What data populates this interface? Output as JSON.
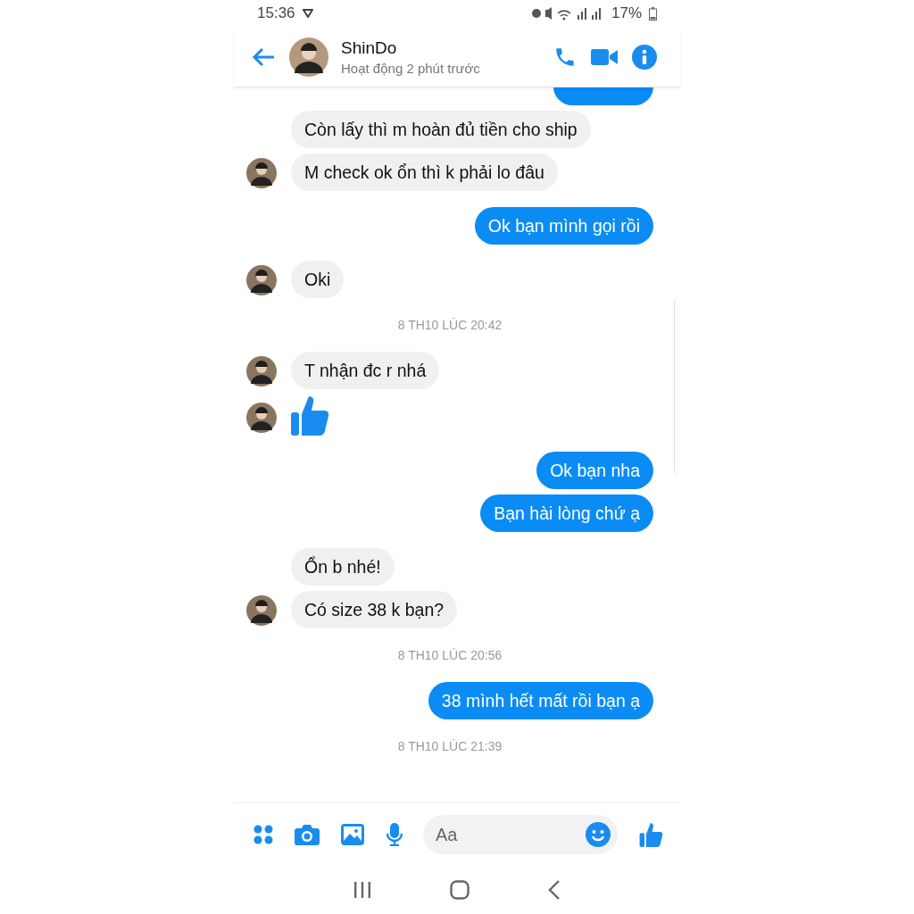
{
  "status_bar": {
    "time": "15:36",
    "battery": "17%"
  },
  "header": {
    "name": "ShinDo",
    "presence": "Hoạt động 2 phút trước"
  },
  "messages": [
    {
      "kind": "partial"
    },
    {
      "kind": "in",
      "text": "Còn lấy thì m hoàn đủ tiền cho ship",
      "avatar": false
    },
    {
      "kind": "in",
      "text": "M check ok ổn thì k phải lo đâu",
      "avatar": true
    },
    {
      "kind": "out",
      "text": "Ok bạn mình gọi rồi"
    },
    {
      "kind": "in",
      "text": "Oki",
      "avatar": true
    },
    {
      "kind": "time",
      "text": "8 TH10 LÚC 20:42"
    },
    {
      "kind": "in",
      "text": "T nhận đc r nhá",
      "avatar": true
    },
    {
      "kind": "like",
      "avatar": true
    },
    {
      "kind": "out",
      "text": "Ok bạn nha"
    },
    {
      "kind": "out",
      "text": "Bạn hài lòng chứ ạ"
    },
    {
      "kind": "in",
      "text": "Ổn b nhé!",
      "avatar": false
    },
    {
      "kind": "in",
      "text": "Có size 38 k bạn?",
      "avatar": true
    },
    {
      "kind": "time",
      "text": "8 TH10 LÚC 20:56"
    },
    {
      "kind": "out",
      "text": "38 mình hết mất rồi bạn ạ"
    },
    {
      "kind": "time",
      "text": "8 TH10 LÚC 21:39"
    }
  ],
  "composer": {
    "placeholder": "Aa"
  }
}
